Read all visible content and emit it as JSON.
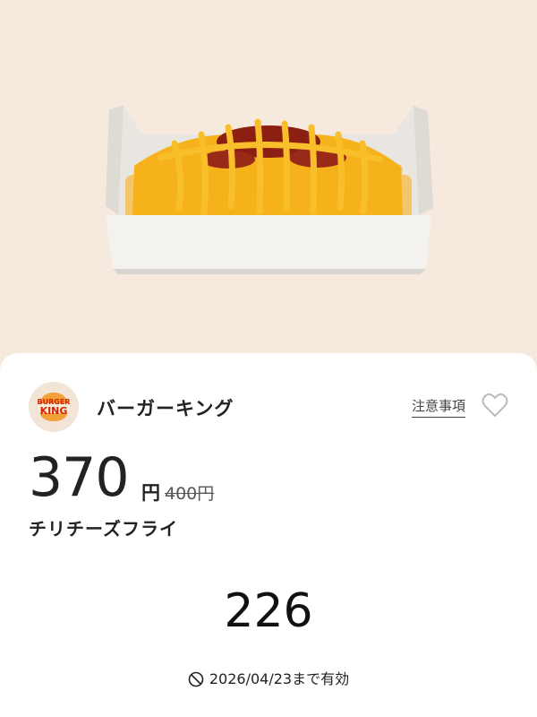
{
  "coupon": {
    "brand": {
      "name": "バーガーキング",
      "logo_top": "BURGER",
      "logo_bottom": "KING",
      "logo_icon": "burger-king-logo"
    },
    "notes_label": "注意事項",
    "favorite_icon": "heart-outline-icon",
    "price": "370",
    "price_unit": "円",
    "original_price": "400円",
    "product_name": "チリチーズフライ",
    "code": "226",
    "expiry_icon": "clock-icon",
    "expiry_text": "2026/04/23まで有効"
  },
  "colors": {
    "background": "#f6e9de",
    "card": "#ffffff",
    "text": "#222222",
    "cheese": "#f5b21b",
    "chili": "#8a1f12",
    "logo_red": "#d62300",
    "logo_orange": "#f2a03a"
  }
}
